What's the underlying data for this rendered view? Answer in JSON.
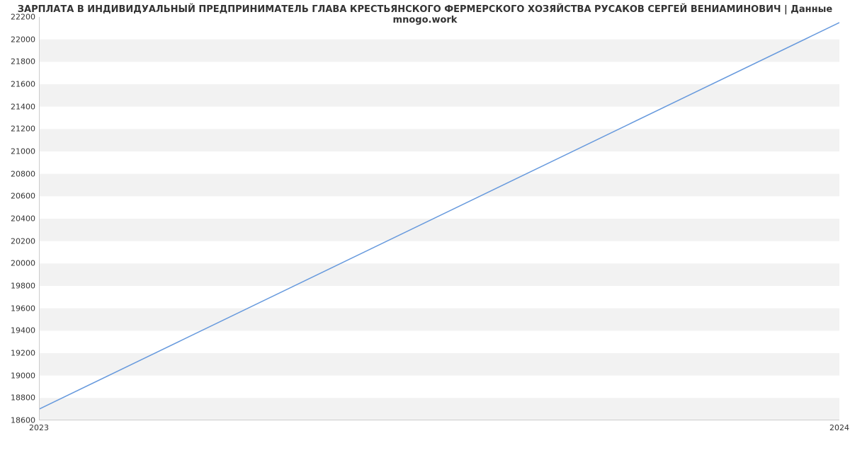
{
  "chart_data": {
    "type": "line",
    "title": "ЗАРПЛАТА В ИНДИВИДУАЛЬНЫЙ ПРЕДПРИНИМАТЕЛЬ ГЛАВА КРЕСТЬЯНСКОГО ФЕРМЕРСКОГО ХОЗЯЙСТВА РУСАКОВ СЕРГЕЙ ВЕНИАМИНОВИЧ | Данные mnogo.work",
    "xlabel": "",
    "ylabel": "",
    "x_ticks": [
      "2023",
      "2024"
    ],
    "y_ticks": [
      18600,
      18800,
      19000,
      19200,
      19400,
      19600,
      19800,
      20000,
      20200,
      20400,
      20600,
      20800,
      21000,
      21200,
      21400,
      21600,
      21800,
      22000,
      22200
    ],
    "ylim": [
      18600,
      22200
    ],
    "xlim": [
      2023,
      2024
    ],
    "series": [
      {
        "name": "salary",
        "color": "#6699dd",
        "x": [
          2023,
          2024
        ],
        "y": [
          18700,
          22150
        ]
      }
    ],
    "grid": {
      "y_bands": true
    }
  }
}
